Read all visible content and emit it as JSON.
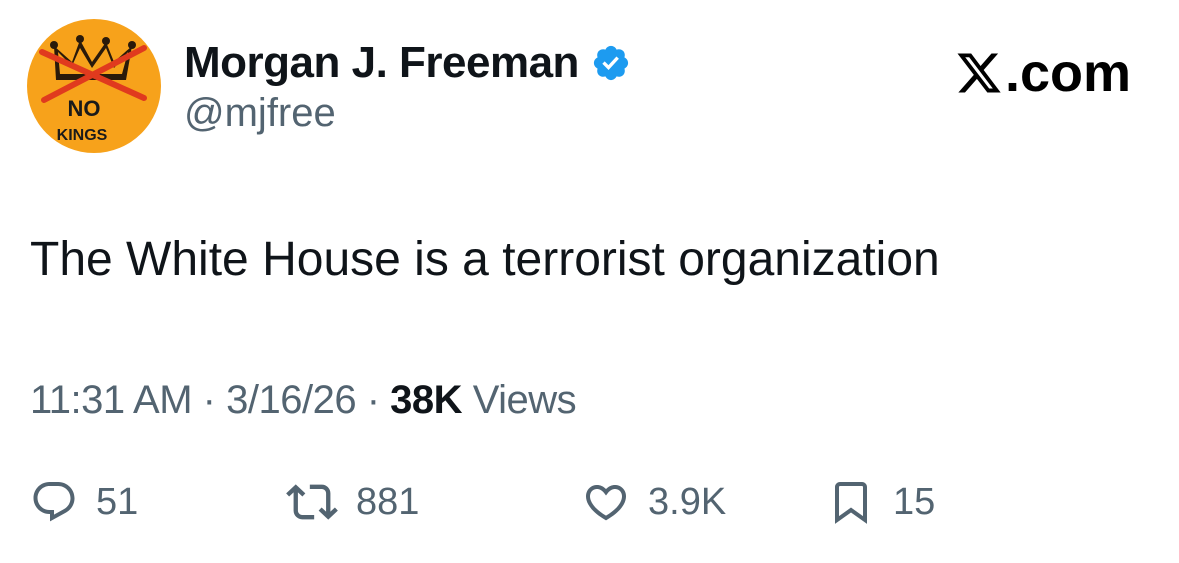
{
  "author": {
    "display_name": "Morgan J. Freeman",
    "handle": "@mjfree",
    "avatar": {
      "line1": "NO",
      "line2": "KINGS",
      "background_color": "#f7a21b",
      "icon": "crossed-out-crown"
    },
    "verified": true,
    "verified_color": "#1d9bf0"
  },
  "site": {
    "label": ".com",
    "logo_icon": "x-logo"
  },
  "tweet": {
    "text": "The White House is a terrorist organization"
  },
  "meta": {
    "time": "11:31 AM",
    "separator": "·",
    "date": "3/16/26",
    "views_count": "38K",
    "views_label": "Views"
  },
  "actions": {
    "replies": "51",
    "reposts": "881",
    "likes": "3.9K",
    "bookmarks": "15"
  },
  "colors": {
    "text_primary": "#0f1419",
    "text_secondary": "#536471",
    "accent": "#1d9bf0"
  }
}
